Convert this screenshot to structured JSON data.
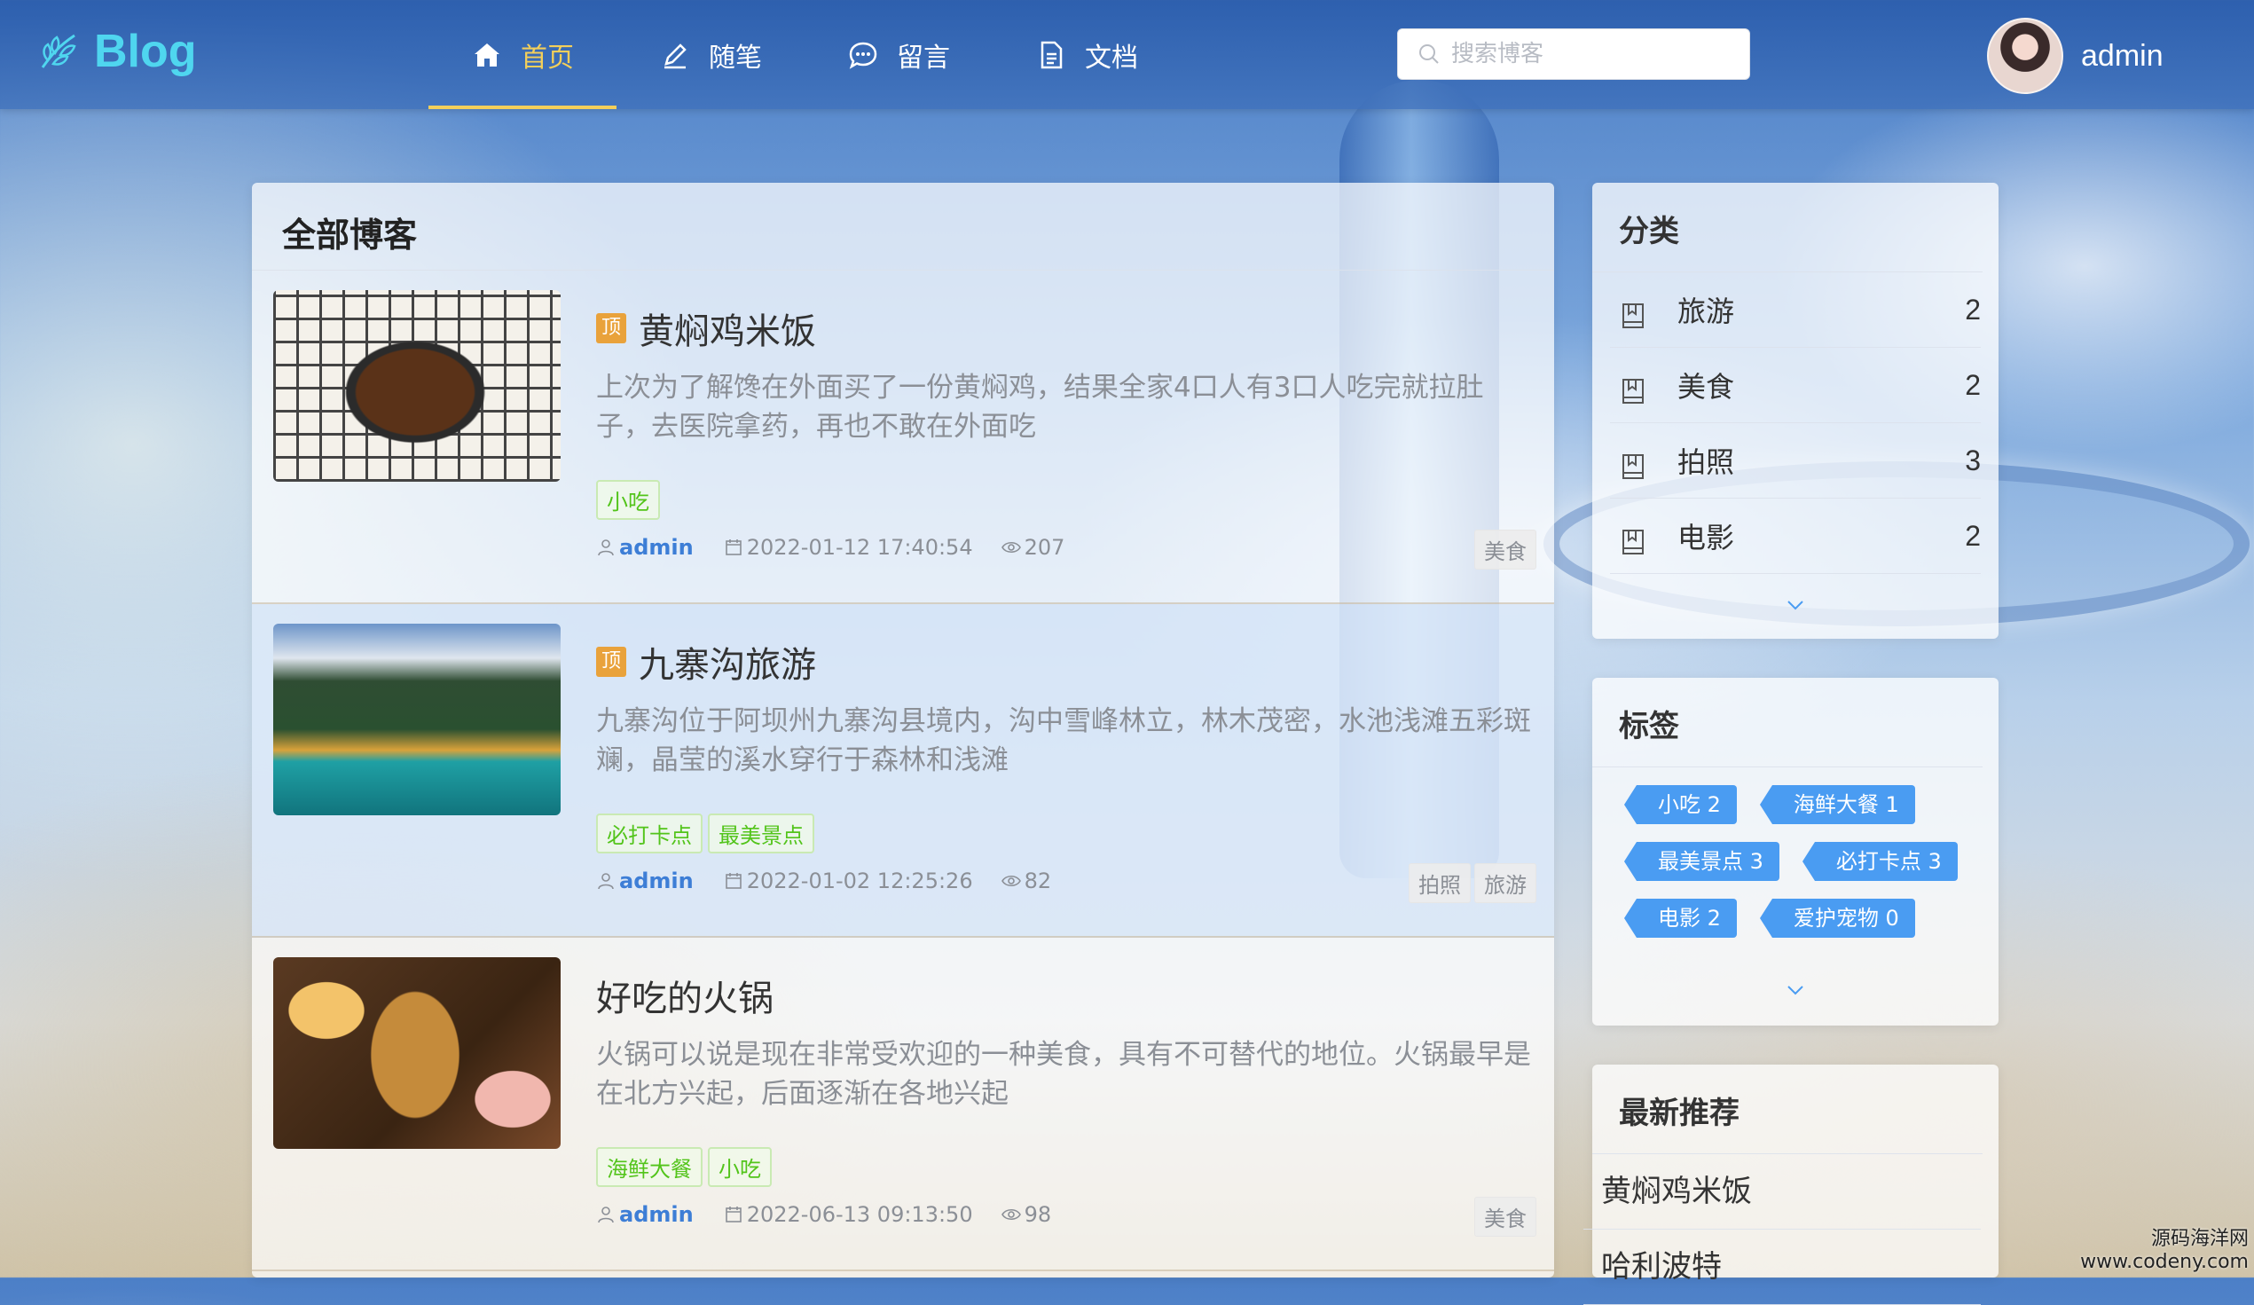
{
  "header": {
    "logo_text": "Blog",
    "nav": [
      {
        "label": "首页",
        "icon": "home-icon",
        "active": true
      },
      {
        "label": "随笔",
        "icon": "pen-icon"
      },
      {
        "label": "留言",
        "icon": "message-icon"
      },
      {
        "label": "文档",
        "icon": "document-icon"
      }
    ],
    "search_placeholder": "搜索博客",
    "username": "admin"
  },
  "main": {
    "title": "全部博客",
    "posts": [
      {
        "pinned": true,
        "pin_label": "顶",
        "title": "黄焖鸡米饭",
        "excerpt": "上次为了解馋在外面买了一份黄焖鸡，结果全家4口人有3口人吃完就拉肚子，去医院拿药，再也不敢在外面吃",
        "tags": [
          "小吃"
        ],
        "author": "admin",
        "date": "2022-01-12 17:40:54",
        "views": "207",
        "categories": [
          "美食"
        ]
      },
      {
        "pinned": true,
        "pin_label": "顶",
        "title": "九寨沟旅游",
        "excerpt": "九寨沟位于阿坝州九寨沟县境内，沟中雪峰林立，林木茂密，水池浅滩五彩斑斓，晶莹的溪水穿行于森林和浅滩",
        "tags": [
          "必打卡点",
          "最美景点"
        ],
        "author": "admin",
        "date": "2022-01-02 12:25:26",
        "views": "82",
        "categories": [
          "拍照",
          "旅游"
        ]
      },
      {
        "pinned": false,
        "title": "好吃的火锅",
        "excerpt": "火锅可以说是现在非常受欢迎的一种美食，具有不可替代的地位。火锅最早是在北方兴起，后面逐渐在各地兴起",
        "tags": [
          "海鲜大餐",
          "小吃"
        ],
        "author": "admin",
        "date": "2022-06-13 09:13:50",
        "views": "98",
        "categories": [
          "美食"
        ]
      }
    ]
  },
  "sidebar": {
    "categories_title": "分类",
    "categories": [
      {
        "name": "旅游",
        "count": "2"
      },
      {
        "name": "美食",
        "count": "2"
      },
      {
        "name": "拍照",
        "count": "3"
      },
      {
        "name": "电影",
        "count": "2"
      }
    ],
    "tags_title": "标签",
    "tags": [
      "小吃 2",
      "海鲜大餐 1",
      "最美景点 3",
      "必打卡点 3",
      "电影 2",
      "爱护宠物 0"
    ],
    "recommend_title": "最新推荐",
    "recommend": [
      "黄焖鸡米饭",
      "哈利波特"
    ]
  },
  "watermark": [
    "源码海洋网",
    "www.codeny.com"
  ],
  "colors": {
    "logo": "#4fd6ef",
    "nav_active": "#f3cf5a",
    "tag_green": "#52c41a",
    "tag_blue": "#4a9cf2",
    "pin": "#e9a23b"
  }
}
